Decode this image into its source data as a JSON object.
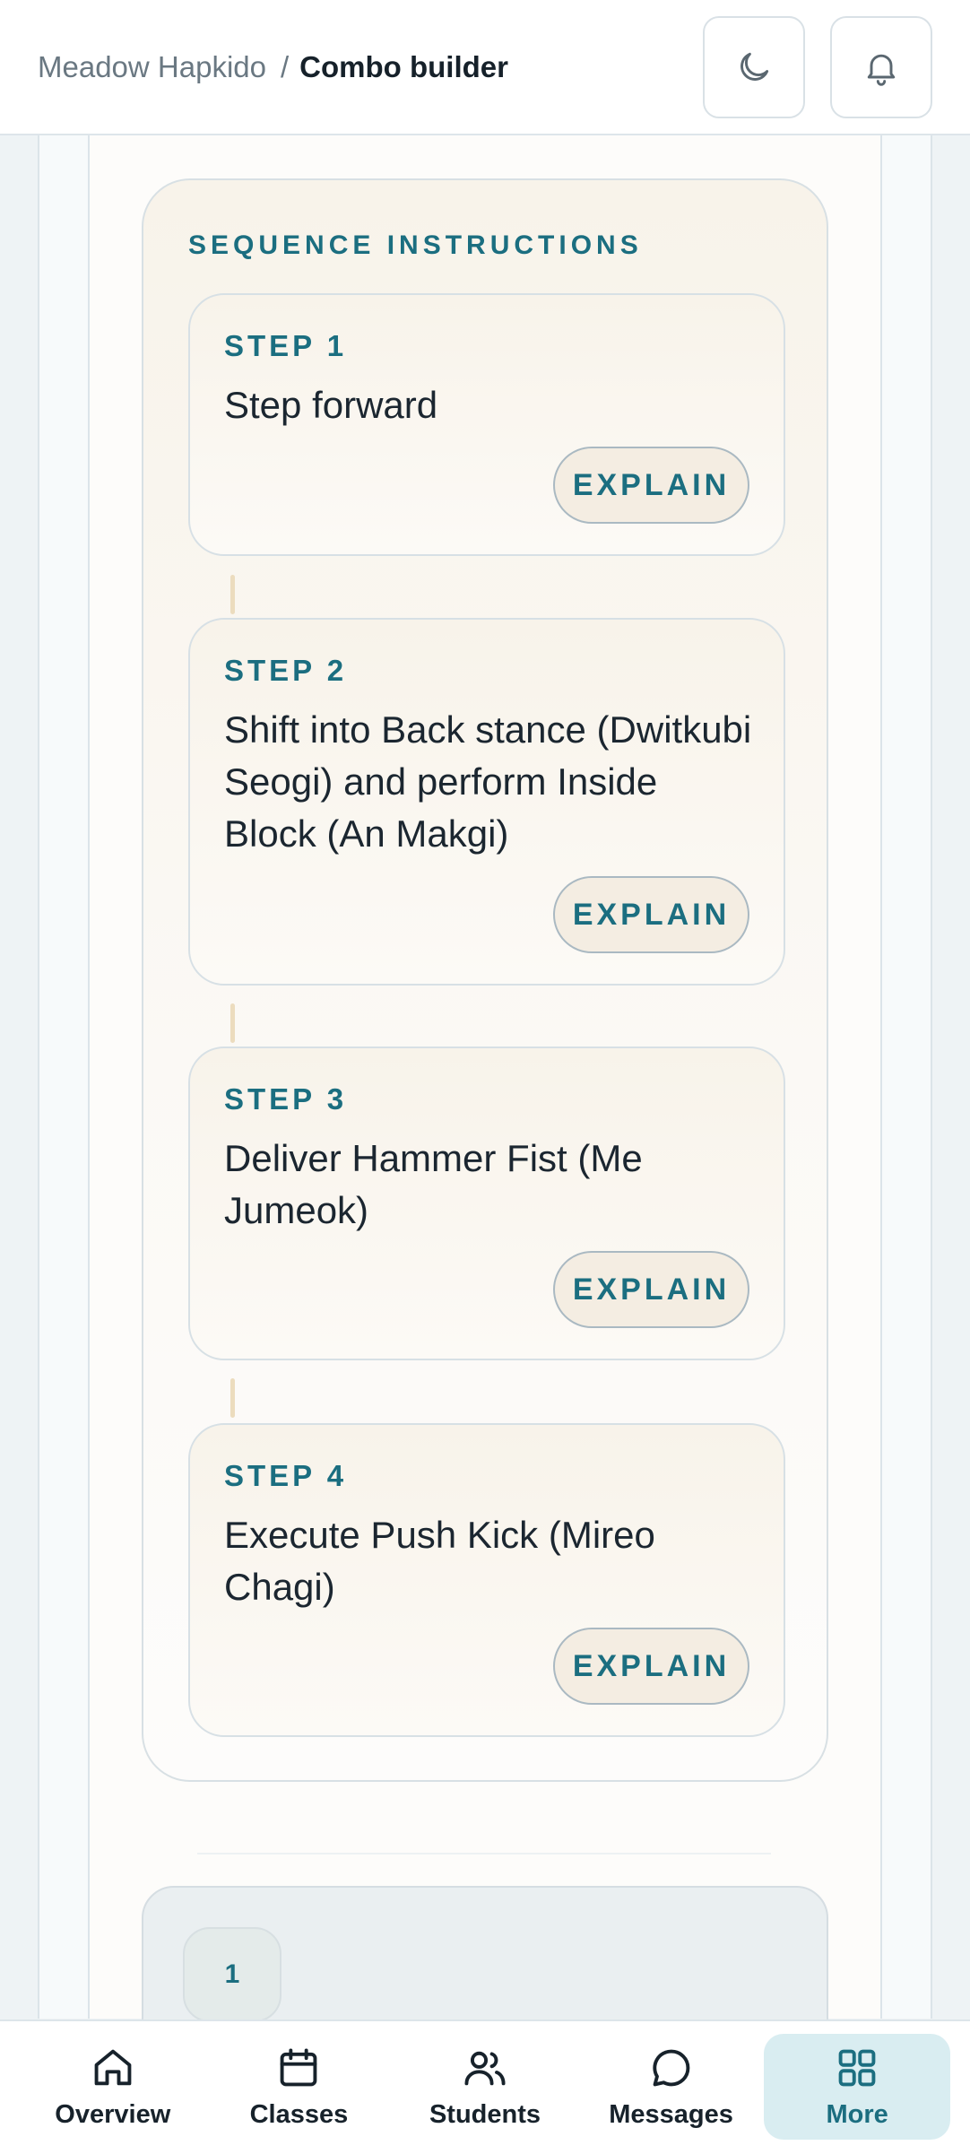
{
  "header": {
    "org": "Meadow Hapkido",
    "separator": "/",
    "page_title": "Combo builder",
    "icons": [
      "moon-icon",
      "bell-icon"
    ]
  },
  "sequence": {
    "title": "SEQUENCE INSTRUCTIONS",
    "steps": [
      {
        "label": "STEP 1",
        "text": "Step forward",
        "button": "EXPLAIN"
      },
      {
        "label": "STEP 2",
        "text": "Shift into Back stance (Dwitkubi Seogi) and perform Inside Block (An Makgi)",
        "button": "EXPLAIN"
      },
      {
        "label": "STEP 3",
        "text": "Deliver Hammer Fist (Me Jumeok)",
        "button": "EXPLAIN"
      },
      {
        "label": "STEP 4",
        "text": "Execute Push Kick (Mireo Chagi)",
        "button": "EXPLAIN"
      }
    ]
  },
  "lower": {
    "chip": "1"
  },
  "nav": {
    "items": [
      {
        "label": "Overview",
        "icon": "home-icon"
      },
      {
        "label": "Classes",
        "icon": "calendar-icon"
      },
      {
        "label": "Students",
        "icon": "users-icon"
      },
      {
        "label": "Messages",
        "icon": "chat-bubble-icon"
      },
      {
        "label": "More",
        "icon": "grid-icon"
      }
    ],
    "active": "More"
  },
  "colors": {
    "accent": "#1b6e80",
    "active_bg": "#d9edf1",
    "card_bg": "#f8f3ea"
  }
}
